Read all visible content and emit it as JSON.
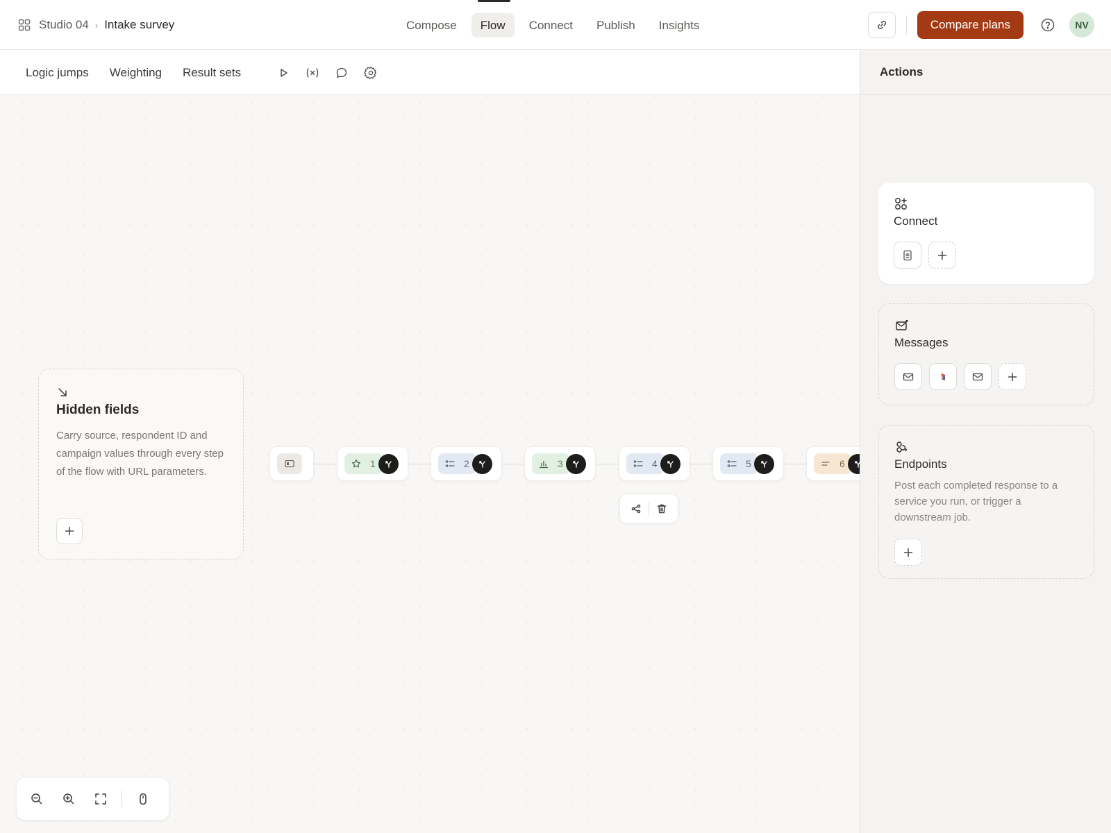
{
  "header": {
    "workspace": "Studio 04",
    "separator": "›",
    "form_name": "Intake survey",
    "tabs": [
      {
        "label": "Compose",
        "active": false
      },
      {
        "label": "Flow",
        "active": true
      },
      {
        "label": "Connect",
        "active": false
      },
      {
        "label": "Publish",
        "active": false
      },
      {
        "label": "Insights",
        "active": false
      }
    ],
    "cta_label": "Compare plans",
    "avatar_initials": "NV",
    "accent": "#a43a13"
  },
  "subbar": {
    "tabs": [
      "Logic jumps",
      "Weighting",
      "Result sets"
    ],
    "icons": [
      "play-icon",
      "variables-icon",
      "comment-icon",
      "settings-icon"
    ]
  },
  "canvas": {
    "hidden_fields": {
      "title": "Hidden fields",
      "description": "Carry source, respondent ID and campaign values through every step of the flow with URL parameters."
    },
    "nodes": [
      {
        "number": "",
        "icon": "welcome-screen-icon",
        "color": "#ece9e5"
      },
      {
        "number": "1",
        "icon": "star-icon",
        "color": "#e2efe3"
      },
      {
        "number": "2",
        "icon": "list-icon",
        "color": "#e3e9f2"
      },
      {
        "number": "3",
        "icon": "bar-chart-icon",
        "color": "#e2efe3"
      },
      {
        "number": "4",
        "icon": "list-icon",
        "color": "#e3e9f2"
      },
      {
        "number": "5",
        "icon": "list-icon",
        "color": "#e3e9f2"
      },
      {
        "number": "6",
        "icon": "text-icon",
        "color": "#f6e7d5"
      }
    ]
  },
  "panel": {
    "title": "Actions",
    "connect": {
      "title": "Connect"
    },
    "messages": {
      "title": "Messages"
    },
    "endpoints": {
      "title": "Endpoints",
      "description": "Post each completed response to a service you run, or trigger a downstream job."
    }
  }
}
